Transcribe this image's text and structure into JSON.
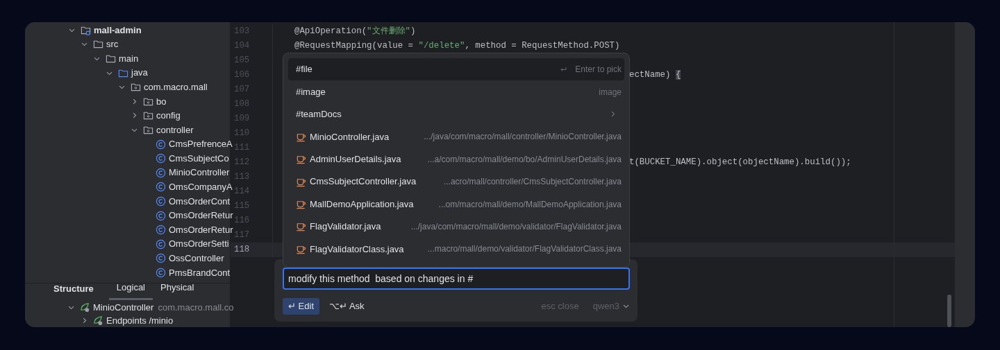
{
  "project_tree": [
    {
      "label": "mall-admin",
      "kind": "module",
      "expanded": true,
      "children": [
        {
          "label": "src",
          "kind": "folder",
          "expanded": true,
          "children": [
            {
              "label": "main",
              "kind": "folder",
              "expanded": true,
              "children": [
                {
                  "label": "java",
                  "kind": "source",
                  "expanded": true,
                  "children": [
                    {
                      "label": "com.macro.mall",
                      "kind": "package",
                      "expanded": true,
                      "children": [
                        {
                          "label": "bo",
                          "kind": "package",
                          "expanded": false
                        },
                        {
                          "label": "config",
                          "kind": "package",
                          "expanded": false
                        },
                        {
                          "label": "controller",
                          "kind": "package",
                          "expanded": true,
                          "children": [
                            {
                              "label": "CmsPrefrenceA",
                              "kind": "class"
                            },
                            {
                              "label": "CmsSubjectCo",
                              "kind": "class"
                            },
                            {
                              "label": "MinioController",
                              "kind": "class"
                            },
                            {
                              "label": "OmsCompanyA",
                              "kind": "class"
                            },
                            {
                              "label": "OmsOrderCont",
                              "kind": "class"
                            },
                            {
                              "label": "OmsOrderRetur",
                              "kind": "class"
                            },
                            {
                              "label": "OmsOrderRetur",
                              "kind": "class"
                            },
                            {
                              "label": "OmsOrderSetti",
                              "kind": "class"
                            },
                            {
                              "label": "OssController",
                              "kind": "class"
                            },
                            {
                              "label": "PmsBrandCont",
                              "kind": "class"
                            }
                          ]
                        }
                      ]
                    }
                  ]
                }
              ]
            }
          ]
        }
      ]
    }
  ],
  "structure": {
    "title": "Structure",
    "tabs": [
      {
        "label": "Logical",
        "selected": true
      },
      {
        "label": "Physical",
        "selected": false
      }
    ],
    "tree": [
      {
        "label": "MinioController",
        "detail": "com.macro.mall.co",
        "expanded": true,
        "children": [
          {
            "label": "Endpoints /minio",
            "expanded": false
          }
        ]
      }
    ]
  },
  "code_lines": [
    {
      "number": "103",
      "current": false,
      "tokens": [
        {
          "text": "@ApiOperation(",
          "kind": "plain"
        },
        {
          "text": "\"文件删除\"",
          "kind": "string"
        },
        {
          "text": ")",
          "kind": "plain"
        }
      ]
    },
    {
      "number": "104",
      "current": false,
      "tokens": [
        {
          "text": "@RequestMapping(value = ",
          "kind": "plain"
        },
        {
          "text": "\"/delete\"",
          "kind": "string"
        },
        {
          "text": ", method = RequestMethod.POST)",
          "kind": "plain"
        }
      ]
    },
    {
      "number": "105",
      "current": false
    },
    {
      "number": "106",
      "current": false,
      "right_tokens": [
        {
          "text": "ectName) ",
          "kind": "plain"
        },
        {
          "text": "{",
          "kind": "brace"
        }
      ]
    },
    {
      "number": "107",
      "current": false
    },
    {
      "number": "108",
      "current": false
    },
    {
      "number": "109",
      "current": false
    },
    {
      "number": "110",
      "current": false
    },
    {
      "number": "111",
      "current": false
    },
    {
      "number": "112",
      "current": false,
      "right_tokens": [
        {
          "text": "t(BUCKET_NAME).object(objectName).build());",
          "kind": "plain"
        }
      ]
    },
    {
      "number": "113",
      "current": false
    },
    {
      "number": "114",
      "current": false
    },
    {
      "number": "115",
      "current": false
    },
    {
      "number": "116",
      "current": false
    },
    {
      "number": "117",
      "current": false
    },
    {
      "number": "118",
      "current": true
    }
  ],
  "completion_popup": {
    "items": [
      {
        "kind": "command",
        "label": "#file",
        "hint": "Enter to pick",
        "selected": true
      },
      {
        "kind": "command",
        "label": "#image",
        "hint": "image",
        "selected": false
      },
      {
        "kind": "submenu",
        "label": "#teamDocs",
        "selected": false
      },
      {
        "kind": "file",
        "label": "MinioController.java",
        "path": ".../java/com/macro/mall/controller/MinioController.java",
        "selected": false
      },
      {
        "kind": "file",
        "label": "AdminUserDetails.java",
        "path": "...a/com/macro/mall/demo/bo/AdminUserDetails.java",
        "selected": false
      },
      {
        "kind": "file",
        "label": "CmsSubjectController.java",
        "path": "...acro/mall/controller/CmsSubjectController.java",
        "selected": false
      },
      {
        "kind": "file",
        "label": "MallDemoApplication.java",
        "path": "...om/macro/mall/demo/MallDemoApplication.java",
        "selected": false
      },
      {
        "kind": "file",
        "label": "FlagValidator.java",
        "path": ".../java/com/macro/mall/demo/validator/FlagValidator.java",
        "selected": false
      },
      {
        "kind": "file",
        "label": "FlagValidatorClass.java",
        "path": "...macro/mall/demo/validator/FlagValidatorClass.java",
        "selected": false
      }
    ]
  },
  "prompt": {
    "value": "modify this method  based on changes in #",
    "modes": [
      {
        "label": "↵ Edit",
        "selected": true
      },
      {
        "label": "⌥↵ Ask",
        "selected": false
      }
    ],
    "close_hint": "esc close",
    "model": "qwen3"
  }
}
